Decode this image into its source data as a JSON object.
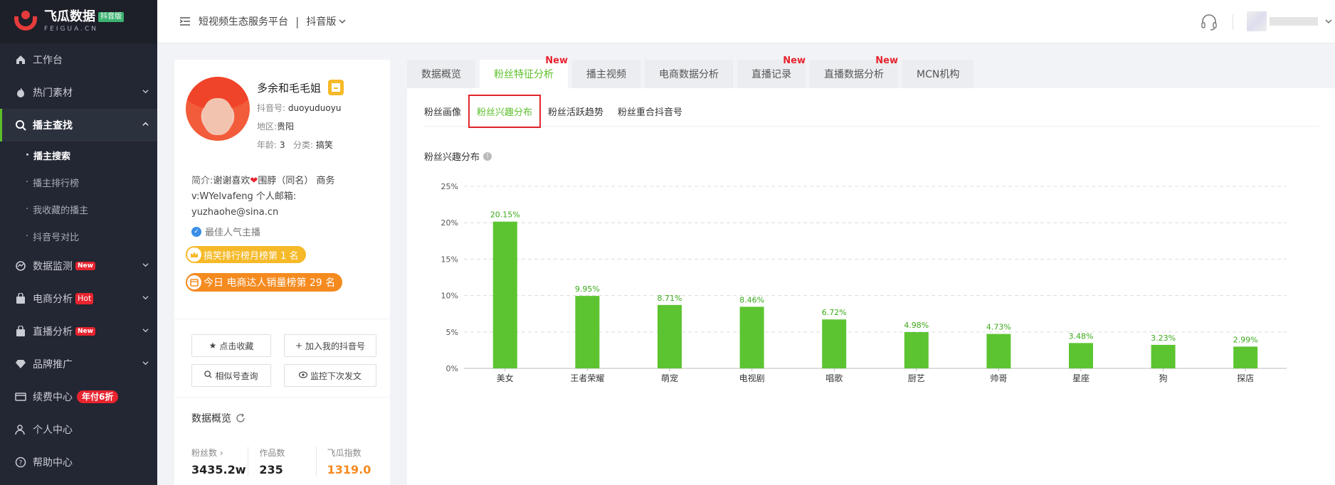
{
  "logo": {
    "name": "飞瓜数据",
    "badge": "抖音版",
    "domain": "FEIGUA.CN"
  },
  "sidebar": {
    "items": [
      {
        "label": "工作台",
        "icon": "home-icon"
      },
      {
        "label": "热门素材",
        "icon": "flame-icon"
      },
      {
        "label": "播主查找",
        "icon": "search-icon"
      },
      {
        "label": "数据监测",
        "icon": "monitor-icon",
        "tag": "New"
      },
      {
        "label": "电商分析",
        "icon": "bag-icon",
        "tag": "Hot"
      },
      {
        "label": "直播分析",
        "icon": "live-icon",
        "tag": "New"
      },
      {
        "label": "品牌推广",
        "icon": "diamond-icon"
      },
      {
        "label": "续费中心",
        "icon": "card-icon",
        "tag": "年付6折"
      },
      {
        "label": "个人中心",
        "icon": "user-icon"
      },
      {
        "label": "帮助中心",
        "icon": "help-icon"
      }
    ],
    "subitems": [
      "播主搜索",
      "播主排行榜",
      "我收藏的播主",
      "抖音号对比"
    ]
  },
  "header": {
    "platform": "短视频生态服务平台",
    "separator": "|",
    "version": "抖音版"
  },
  "profile": {
    "name": "多余和毛毛姐",
    "account_label": "抖音号:",
    "account": "duoyuduoyu",
    "region_label": "地区:",
    "region": "贵阳",
    "age_label": "年龄:",
    "age": "3",
    "category_label": "分类:",
    "category": "搞笑",
    "bio_label": "简介:",
    "bio_1": "谢谢喜欢",
    "bio_2": "围脖（同名） 商务",
    "bio_3": "v:WYelvafeng 个人邮箱:",
    "bio_4": "yuzhaohe@sina.cn",
    "verified": "最佳人气主播",
    "rank1": "搞笑排行榜月榜第 1 名",
    "rank2": "今日 电商达人销量榜第 29 名",
    "buttons": {
      "favorite": "点击收藏",
      "add_mine": "加入我的抖音号",
      "similar": "相似号查询",
      "monitor": "监控下次发文"
    },
    "overview_title": "数据概览",
    "stats": [
      {
        "label": "粉丝数",
        "value": "3435.2w"
      },
      {
        "label": "作品数",
        "value": "235"
      },
      {
        "label": "飞瓜指数",
        "value": "1319.0"
      }
    ]
  },
  "tabs": [
    {
      "label": "数据概览",
      "new": ""
    },
    {
      "label": "粉丝特征分析",
      "new": "New"
    },
    {
      "label": "播主视频",
      "new": ""
    },
    {
      "label": "电商数据分析",
      "new": ""
    },
    {
      "label": "直播记录",
      "new": "New"
    },
    {
      "label": "直播数据分析",
      "new": "New"
    },
    {
      "label": "MCN机构",
      "new": ""
    }
  ],
  "subtabs": [
    "粉丝画像",
    "粉丝兴趣分布",
    "粉丝活跃趋势",
    "粉丝重合抖音号"
  ],
  "chart_title": "粉丝兴趣分布",
  "colors": {
    "accent": "#5cbf2a",
    "bar": "#5cc431",
    "highlight": "#e0262c",
    "sidebar": "#232733"
  },
  "chart_data": {
    "type": "bar",
    "title": "",
    "xlabel": "",
    "ylabel": "",
    "categories": [
      "美女",
      "王者荣耀",
      "萌宠",
      "电视剧",
      "唱歌",
      "厨艺",
      "帅哥",
      "星座",
      "狗",
      "探店"
    ],
    "values": [
      20.15,
      9.95,
      8.71,
      8.46,
      6.72,
      4.98,
      4.73,
      3.48,
      3.23,
      2.99
    ],
    "value_labels": [
      "20.15%",
      "9.95%",
      "8.71%",
      "8.46%",
      "6.72%",
      "4.98%",
      "4.73%",
      "3.48%",
      "3.23%",
      "2.99%"
    ],
    "yticks": [
      "0%",
      "5%",
      "10%",
      "15%",
      "20%",
      "25%"
    ],
    "ylim": [
      0,
      25
    ],
    "grid": true
  }
}
